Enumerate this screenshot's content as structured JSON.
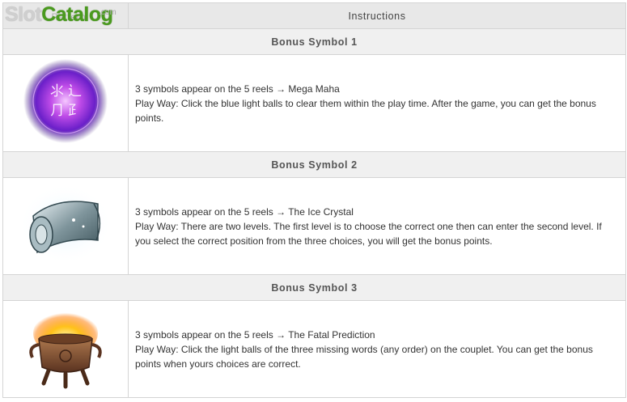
{
  "table": {
    "columns": [
      "Pattern",
      "Instructions"
    ],
    "sections": [
      {
        "title": "Bonus Symbol 1",
        "icon": "purple-orb-icon",
        "line1": "3 symbols appear on the 5 reels → Mega Maha",
        "line2": "Play Way: Click the blue light balls to clear them within the play time. After the game, you can get the bonus points."
      },
      {
        "title": "Bonus Symbol 2",
        "icon": "ice-crystal-scroll-icon",
        "line1": "3 symbols appear on the 5 reels → The Ice Crystal",
        "line2": "Play Way: There are two levels. The first level is to choose the correct one then can enter the second level. If you select the correct position from the three choices, you will get the bonus points."
      },
      {
        "title": "Bonus Symbol 3",
        "icon": "fire-cauldron-icon",
        "line1": "3 symbols appear on the 5 reels → The Fatal Prediction",
        "line2": "Play Way: Click the light balls of the three missing words (any order) on the couplet. You can get the bonus points when yours choices are correct."
      }
    ]
  },
  "watermark": {
    "slot": "Slot",
    "catalog": "Catalog",
    "com": ".com"
  },
  "colors": {
    "header_bg": "#e8e8e8",
    "section_bg": "#f0f0f0",
    "border": "#d4d4d4",
    "logo_green": "#4a9a1e"
  }
}
